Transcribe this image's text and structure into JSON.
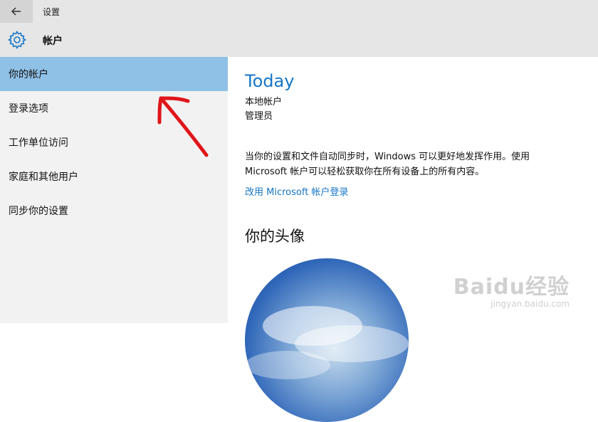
{
  "window": {
    "back_icon": "back-arrow-icon",
    "title": "设置"
  },
  "header": {
    "icon": "gear-icon",
    "title": "帐户"
  },
  "sidebar": {
    "items": [
      {
        "label": "你的帐户",
        "selected": true
      },
      {
        "label": "登录选项",
        "selected": false
      },
      {
        "label": "工作单位访问",
        "selected": false
      },
      {
        "label": "家庭和其他用户",
        "selected": false
      },
      {
        "label": "同步你的设置",
        "selected": false
      }
    ]
  },
  "account": {
    "name": "Today",
    "type": "本地帐户",
    "role": "管理员",
    "description": "当你的设置和文件自动同步时，Windows 可以更好地发挥作用。使用 Microsoft 帐户可以轻松获取你在所有设备上的所有内容。",
    "link": "改用 Microsoft 帐户登录",
    "avatar_heading": "你的头像"
  },
  "watermark": {
    "main": "Baidu经验",
    "sub": "jingyan.baidu.com"
  },
  "colors": {
    "accent": "#1576c7",
    "selected_bg": "#8fc0e6",
    "annotation": "#e0151a"
  }
}
